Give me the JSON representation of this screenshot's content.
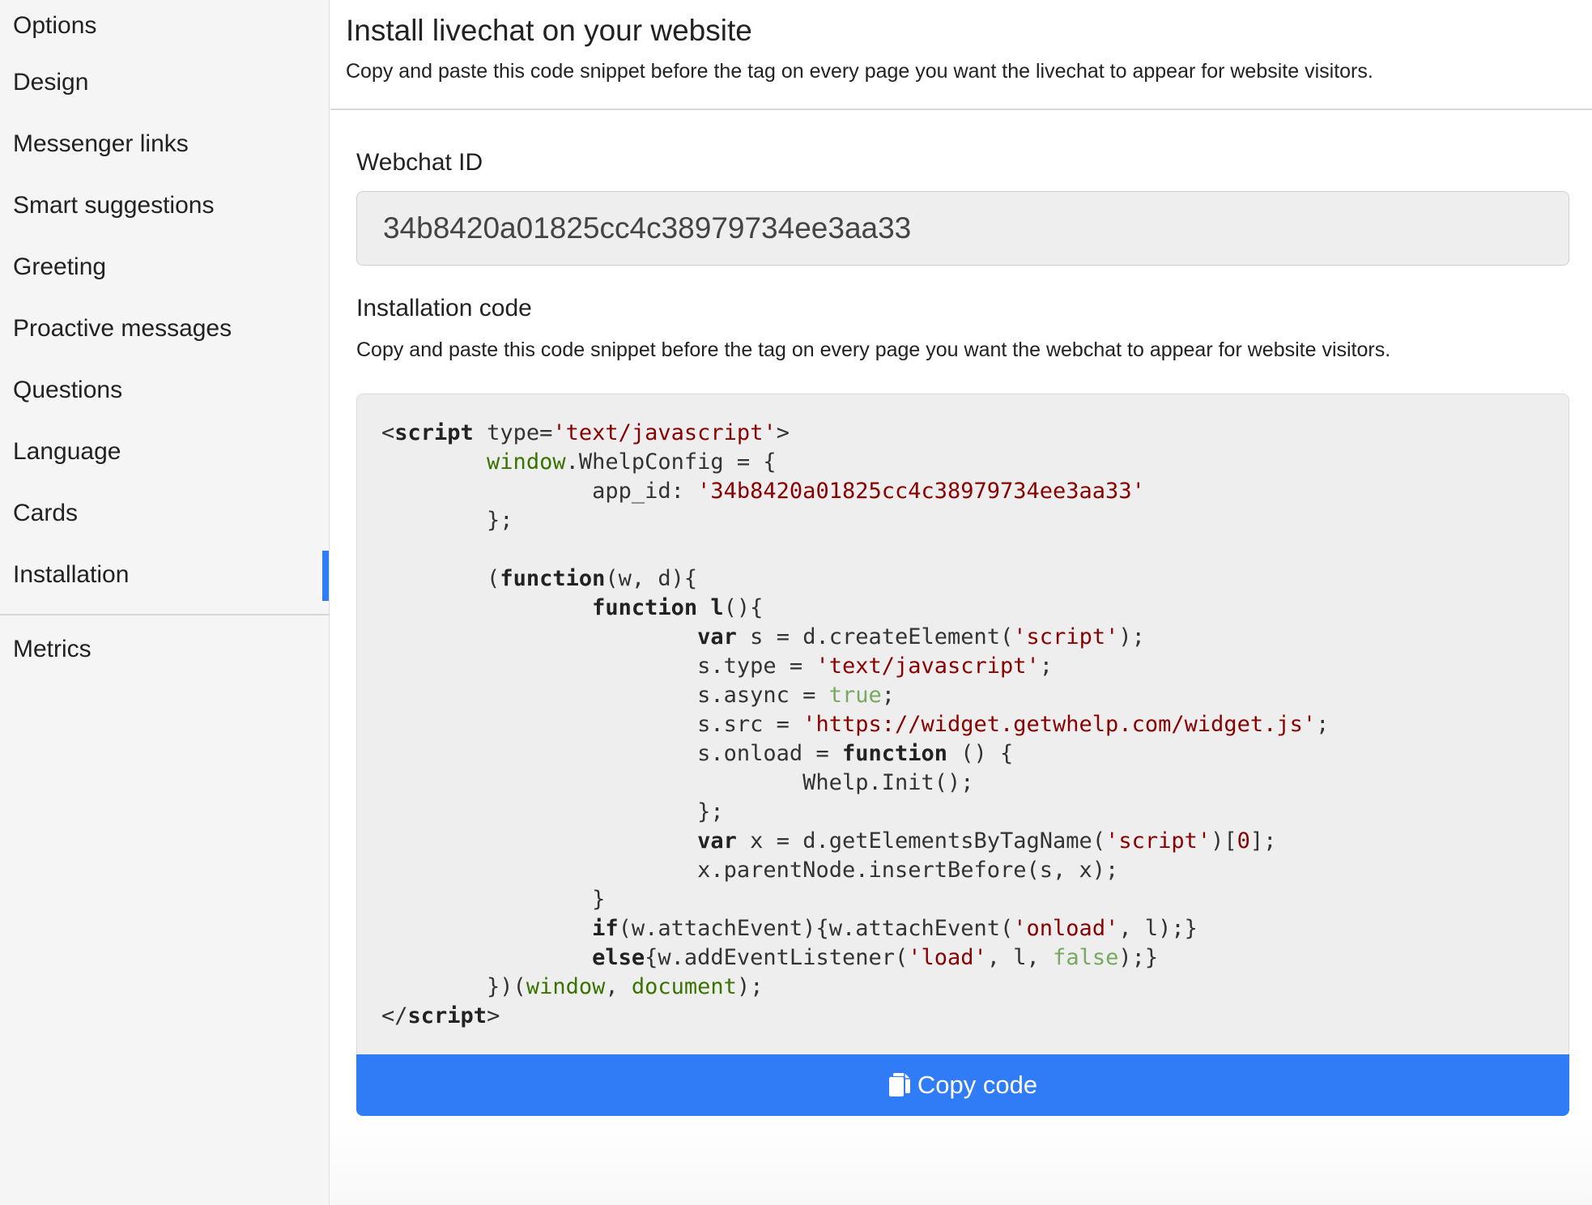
{
  "sidebar": {
    "items": [
      {
        "label": "Options"
      },
      {
        "label": "Design"
      },
      {
        "label": "Messenger links"
      },
      {
        "label": "Smart suggestions"
      },
      {
        "label": "Greeting"
      },
      {
        "label": "Proactive messages"
      },
      {
        "label": "Questions"
      },
      {
        "label": "Language"
      },
      {
        "label": "Cards"
      },
      {
        "label": "Installation",
        "active": true
      },
      {
        "label": "Metrics"
      }
    ]
  },
  "header": {
    "title": "Install livechat on your website",
    "subtitle": "Copy and paste this code snippet before the tag on every page you want the livechat to appear for website visitors."
  },
  "webchat": {
    "label": "Webchat ID",
    "id": "34b8420a01825cc4c38979734ee3aa33"
  },
  "installation": {
    "label": "Installation code",
    "description": "Copy and paste this code snippet before the tag on every page you want the webchat to appear for website visitors.",
    "code": {
      "l1_open": "<",
      "l1_tag": "script",
      "l1_attr": " type=",
      "l1_val": "'text/javascript'",
      "l1_close": ">",
      "l2_window": "window",
      "l2_rest": ".WhelpConfig = {",
      "l3_key": "app_id: ",
      "l3_val": "'34b8420a01825cc4c38979734ee3aa33'",
      "l4": "};",
      "l6_a": "(",
      "l6_fn": "function",
      "l6_b": "(w, d){",
      "l7_fn": "function",
      "l7_name": " l",
      "l7_b": "(){",
      "l8_var": "var",
      "l8_a": " s = d.createElement(",
      "l8_str": "'script'",
      "l8_b": ");",
      "l9_a": "s.type = ",
      "l9_str": "'text/javascript'",
      "l9_b": ";",
      "l10_a": "s.async = ",
      "l10_lit": "true",
      "l10_b": ";",
      "l11_a": "s.src = ",
      "l11_str": "'https://widget.getwhelp.com/widget.js'",
      "l11_b": ";",
      "l12_a": "s.onload = ",
      "l12_fn": "function",
      "l12_b": " () {",
      "l13": "Whelp.Init();",
      "l14": "};",
      "l15_var": "var",
      "l15_a": " x = d.getElementsByTagName(",
      "l15_str": "'script'",
      "l15_b": ")[",
      "l15_num": "0",
      "l15_c": "];",
      "l16": "x.parentNode.insertBefore(s, x);",
      "l17": "}",
      "l18_if": "if",
      "l18_a": "(w.attachEvent){w.attachEvent(",
      "l18_str": "'onload'",
      "l18_b": ", l);}",
      "l19_else": "else",
      "l19_a": "{w.addEventListener(",
      "l19_str": "'load'",
      "l19_b": ", l, ",
      "l19_lit": "false",
      "l19_c": ");}",
      "l20_a": "})(",
      "l20_w": "window",
      "l20_b": ", ",
      "l20_d": "document",
      "l20_c": ");",
      "l21_open": "</",
      "l21_tag": "script",
      "l21_close": ">"
    },
    "copy_label": "Copy code"
  },
  "colors": {
    "accent": "#2f7cf6",
    "string": "#880000",
    "global": "#397300",
    "literal": "#78a960"
  },
  "icons": {
    "copy": "copy-icon"
  }
}
